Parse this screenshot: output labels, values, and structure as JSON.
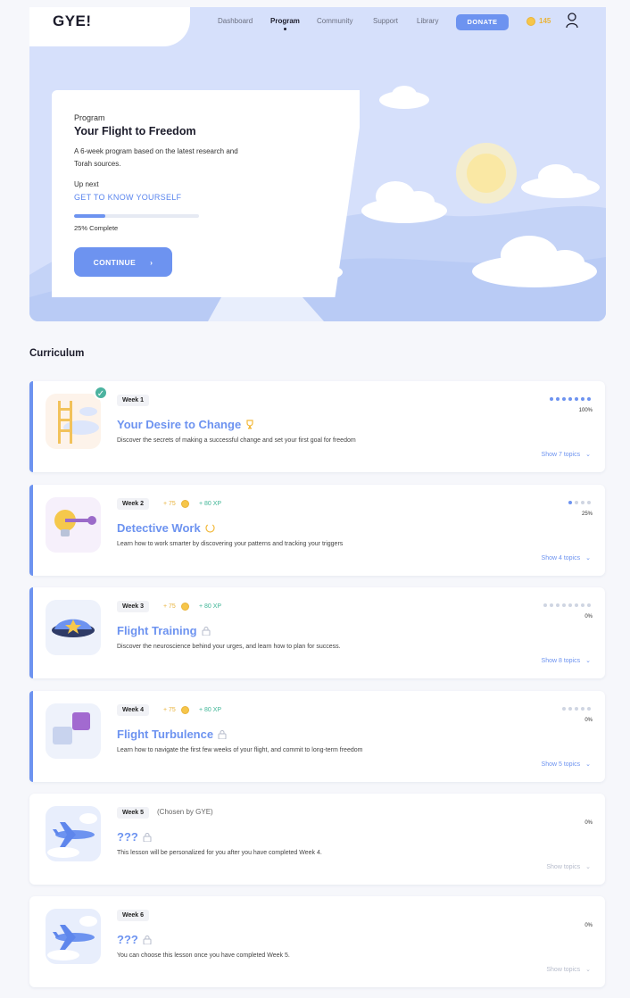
{
  "header": {
    "logo": "GYE!",
    "nav": [
      {
        "label": "Dashboard",
        "active": false
      },
      {
        "label": "Program",
        "active": true
      },
      {
        "label": "Community",
        "active": false
      },
      {
        "label": "Support",
        "active": false
      },
      {
        "label": "Library",
        "active": false
      }
    ],
    "donate_label": "DONATE",
    "coins": "145",
    "user_icon": "user-icon"
  },
  "hero": {
    "eyebrow": "Program",
    "title": "Your Flight to Freedom",
    "description": "A 6-week program based on the latest research and Torah sources.",
    "up_next_label": "Up next",
    "next_lesson": "GET TO KNOW YOURSELF",
    "progress": 0.25,
    "progress_text": "25% Complete",
    "continue_label": "CONTINUE",
    "continue_icon": "chevron-right-icon"
  },
  "curriculum": {
    "title": "Curriculum",
    "weeks": [
      {
        "week": "Week 1",
        "title": "Your Desire to Change",
        "title_icon": "trophy-icon",
        "description": "Discover the secrets of making a successful change and set your first goal for freedom",
        "completed": true,
        "dots_total": 7,
        "dots_done": 7,
        "percent": "100%",
        "topics": "Show 7 topics",
        "coins": "",
        "xp": "",
        "meta": ""
      },
      {
        "week": "Week 2",
        "title": "Detective Work",
        "title_icon": "spinner-icon",
        "description": "Learn how to work smarter by discovering your patterns and tracking your triggers",
        "dots_total": 4,
        "dots_done": 1,
        "percent": "25%",
        "topics": "Show 4 topics",
        "coins": "+ 75",
        "xp": "+ 80  XP",
        "meta": ""
      },
      {
        "week": "Week 3",
        "title": "Flight Training",
        "title_icon": "lock-icon",
        "description": "Discover the neuroscience behind your urges, and learn how to plan for success.",
        "dots_total": 8,
        "dots_done": 0,
        "percent": "0%",
        "topics": "Show 8 topics",
        "coins": "+ 75",
        "xp": "+ 80  XP",
        "meta": ""
      },
      {
        "week": "Week 4",
        "title": "Flight Turbulence",
        "title_icon": "lock-icon",
        "description": "Learn how to navigate the first few weeks of your flight, and commit to long-term freedom",
        "dots_total": 5,
        "dots_done": 0,
        "percent": "0%",
        "topics": "Show 5 topics",
        "coins": "+ 75",
        "xp": "+ 80  XP",
        "meta": ""
      },
      {
        "week": "Week 5",
        "title": "???",
        "title_icon": "lock-icon",
        "description": "This lesson will be personalized for you after you have completed Week 4.",
        "dots_total": 0,
        "dots_done": 0,
        "percent": "0%",
        "topics": "Show topics",
        "coins": "",
        "xp": "",
        "meta": "(Chosen by GYE)"
      },
      {
        "week": "Week 6",
        "title": "???",
        "title_icon": "lock-icon",
        "description": "You can choose this lesson once you have completed Week 5.",
        "dots_total": 0,
        "dots_done": 0,
        "percent": "0%",
        "topics": "Show topics",
        "coins": "",
        "xp": "",
        "meta": ""
      }
    ]
  },
  "colors": {
    "accent": "#6d93f0",
    "hero_bg": "#d6e0fb",
    "coin": "#f6c64a",
    "xp": "#3fb596"
  }
}
